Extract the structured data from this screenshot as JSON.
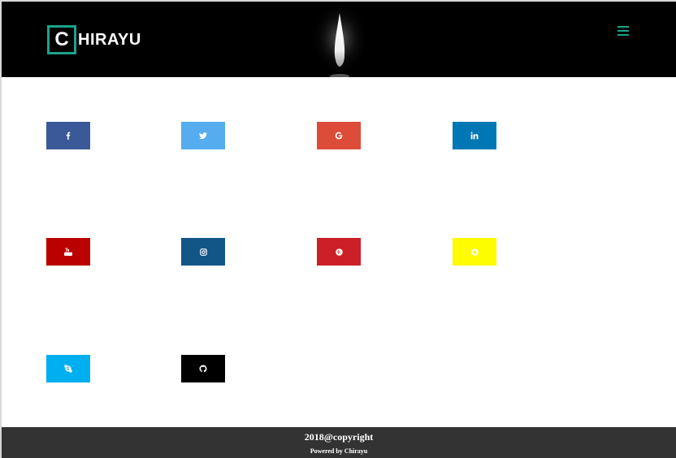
{
  "header": {
    "logo_initial": "C",
    "logo_rest": "HIRAYU",
    "menu_icon": "hamburger-menu-icon",
    "accent_color": "#1aa38a",
    "background_color": "#000000"
  },
  "social_links": [
    {
      "name": "facebook",
      "icon": "facebook-icon",
      "color": "#3b5998"
    },
    {
      "name": "twitter",
      "icon": "twitter-icon",
      "color": "#55acee"
    },
    {
      "name": "google",
      "icon": "google-icon",
      "color": "#dd4b39"
    },
    {
      "name": "linkedin",
      "icon": "linkedin-icon",
      "color": "#0077b5"
    },
    {
      "name": "youtube",
      "icon": "youtube-icon",
      "color": "#bb0000"
    },
    {
      "name": "instagram",
      "icon": "instagram-icon",
      "color": "#125688"
    },
    {
      "name": "pinterest",
      "icon": "pinterest-icon",
      "color": "#cb2027"
    },
    {
      "name": "snapchat",
      "icon": "snapchat-icon",
      "color": "#fffc00"
    },
    {
      "name": "skype",
      "icon": "skype-icon",
      "color": "#00aff0"
    },
    {
      "name": "github",
      "icon": "github-icon",
      "color": "#000000"
    }
  ],
  "footer": {
    "copyright": "2018@copyright",
    "powered_by": "Powered by Chirayu",
    "background_color": "#333333"
  }
}
